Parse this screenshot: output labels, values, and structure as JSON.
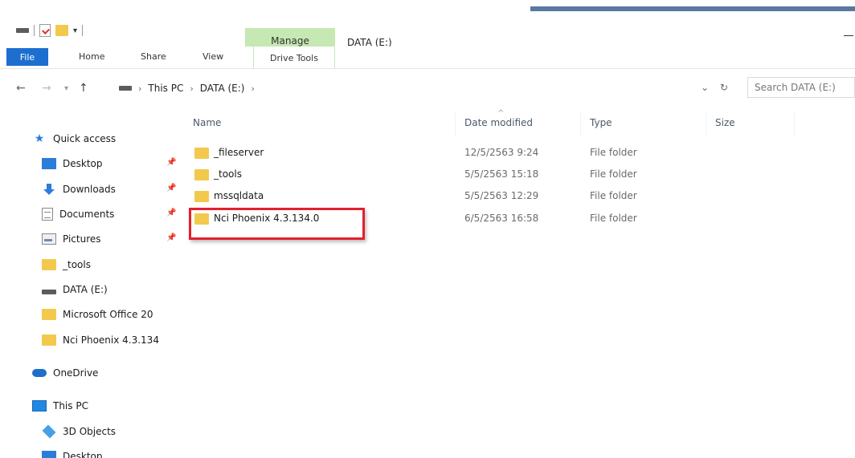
{
  "titlebar": {
    "manage_tab": "Manage",
    "window_title": "DATA (E:)"
  },
  "ribbon": {
    "file": "File",
    "home": "Home",
    "share": "Share",
    "view": "View",
    "drive_tools": "Drive Tools"
  },
  "address": {
    "crumbs": [
      "This PC",
      "DATA (E:)"
    ],
    "search_placeholder": "Search DATA (E:)"
  },
  "columns": [
    "Name",
    "Date modified",
    "Type",
    "Size"
  ],
  "files": [
    {
      "name": "_fileserver",
      "date": "12/5/2563 9:24",
      "type": "File folder"
    },
    {
      "name": "_tools",
      "date": "5/5/2563 15:18",
      "type": "File folder"
    },
    {
      "name": "mssqldata",
      "date": "5/5/2563 12:29",
      "type": "File folder"
    },
    {
      "name": "Nci Phoenix 4.3.134.0",
      "date": "6/5/2563 16:58",
      "type": "File folder"
    }
  ],
  "sidebar": {
    "quick_access": "Quick access",
    "items": [
      {
        "label": "Desktop"
      },
      {
        "label": "Downloads"
      },
      {
        "label": "Documents"
      },
      {
        "label": "Pictures"
      },
      {
        "label": "_tools"
      },
      {
        "label": "DATA (E:)"
      },
      {
        "label": "Microsoft Office 20"
      },
      {
        "label": "Nci Phoenix 4.3.134"
      }
    ],
    "onedrive": "OneDrive",
    "this_pc": "This PC",
    "objects_3d": "3D Objects",
    "desktop2": "Desktop"
  },
  "highlight_color": "#e3202e"
}
